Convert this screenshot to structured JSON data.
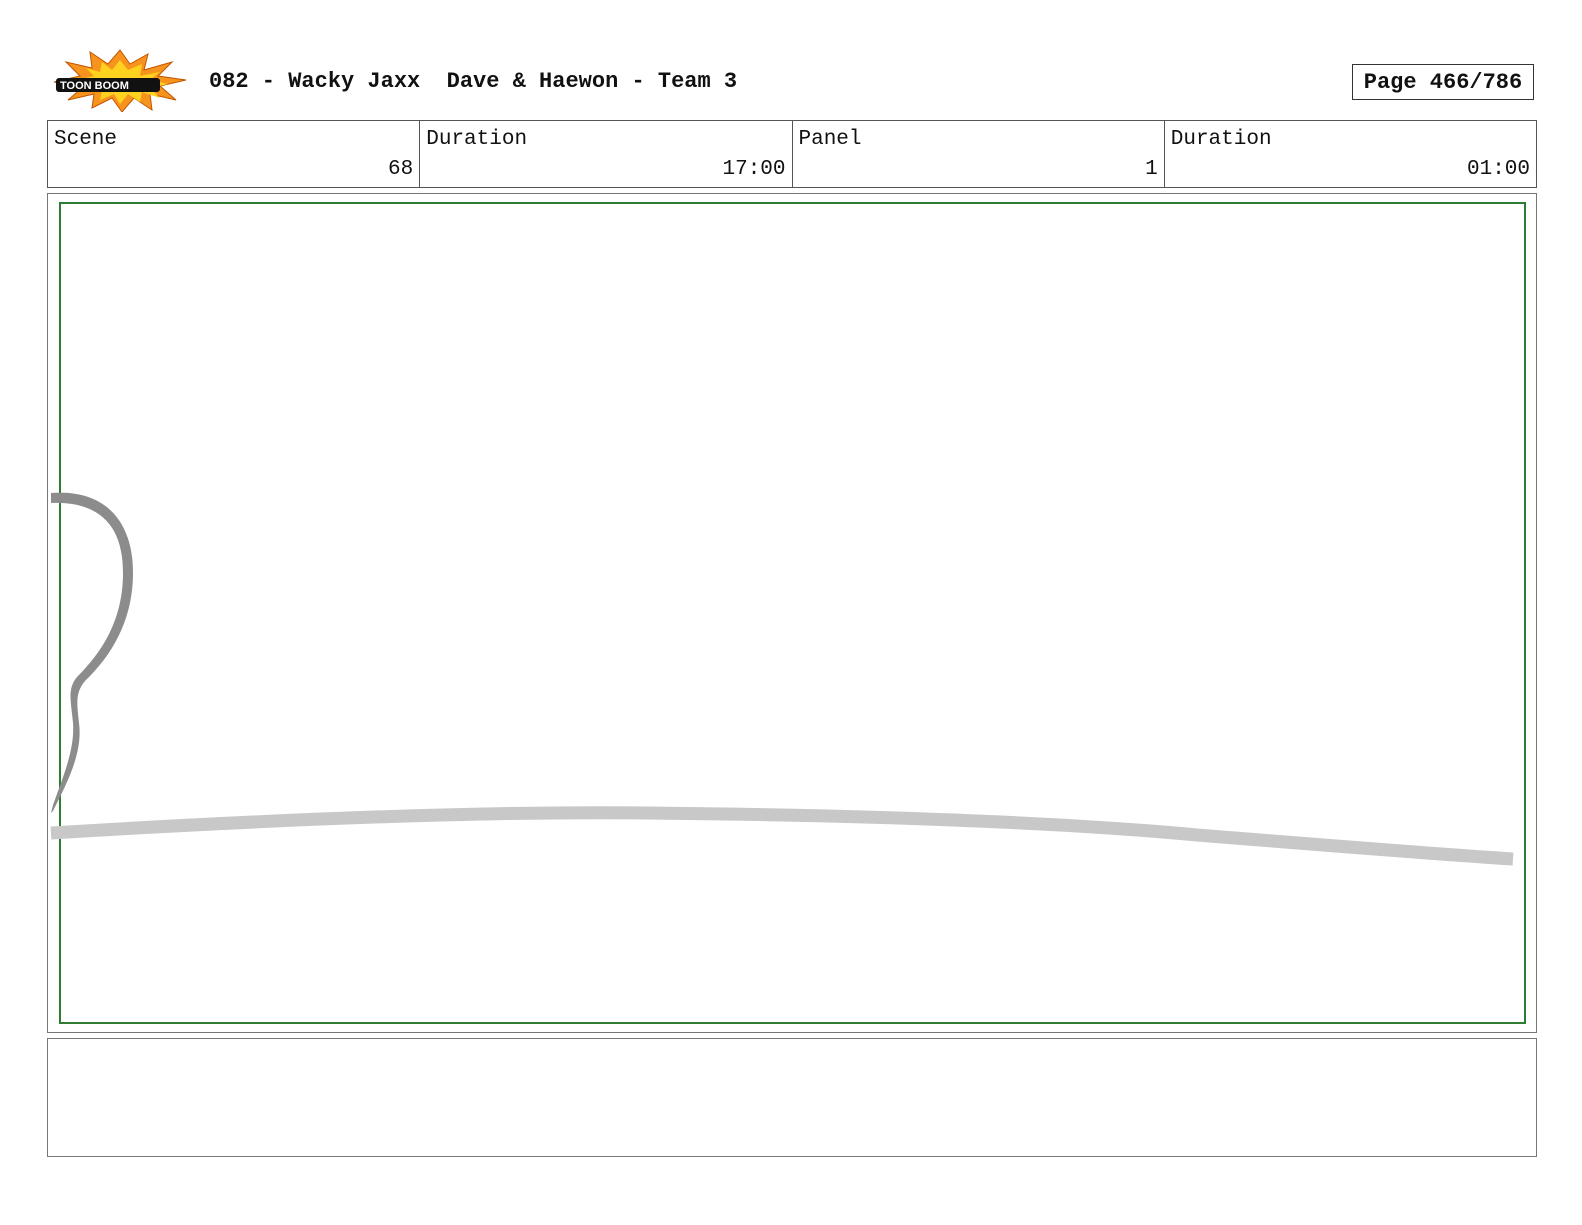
{
  "header": {
    "logo_text": "TOON BOOM",
    "title": "082 - Wacky Jaxx  Dave & Haewon - Team 3",
    "page_label": "Page 466/786"
  },
  "info": {
    "scene_label": "Scene",
    "scene_value": "68",
    "scene_duration_label": "Duration",
    "scene_duration_value": "17:00",
    "panel_label": "Panel",
    "panel_value": "1",
    "panel_duration_label": "Duration",
    "panel_duration_value": "01:00"
  },
  "colors": {
    "safe_frame": "#2e7d32",
    "sketch_dark": "#8c8c8c",
    "sketch_light": "#c8c8c8",
    "logo_orange": "#f7941d",
    "logo_yellow": "#ffd21f"
  }
}
